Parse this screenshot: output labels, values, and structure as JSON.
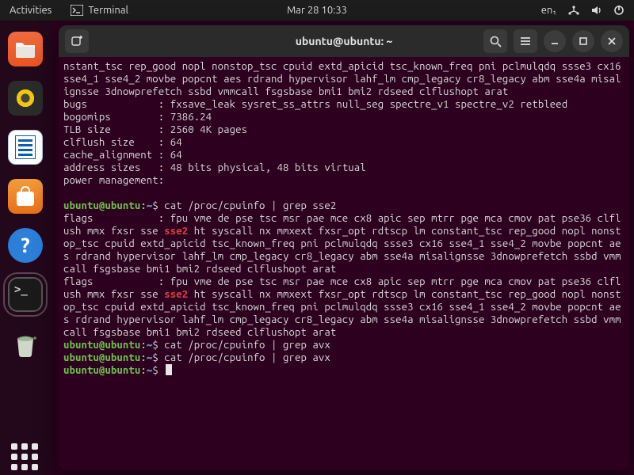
{
  "topbar": {
    "activities": "Activities",
    "app_label": "Terminal",
    "clock": "Mar 28  10:33",
    "lang": "en₁"
  },
  "dock": {
    "items": [
      {
        "name": "files-app"
      },
      {
        "name": "rhythmbox-app"
      },
      {
        "name": "libreoffice-writer-app"
      },
      {
        "name": "ubuntu-software-app"
      },
      {
        "name": "help-app"
      },
      {
        "name": "terminal-app",
        "active": true
      },
      {
        "name": "trash"
      }
    ],
    "show_apps": "show-applications"
  },
  "terminal": {
    "title": "ubuntu@ubuntu: ~",
    "prompt": {
      "userhost": "ubuntu@ubuntu",
      "path": "~",
      "sep": ":"
    },
    "scrollback": {
      "flags_tail": "nstant_tsc rep_good nopl nonstop_tsc cpuid extd_apicid tsc_known_freq pni pclmulqdq ssse3 cx16 sse4_1 sse4_2 movbe popcnt aes rdrand hypervisor lahf_lm cmp_legacy cr8_legacy abm sse4a misalignsse 3dnowprefetch ssbd vmmcall fsgsbase bmi1 bmi2 rdseed clflushopt arat",
      "bugs_label": "bugs",
      "bugs_value": "fxsave_leak sysret_ss_attrs null_seg spectre_v1 spectre_v2 retbleed",
      "bogomips_label": "bogomips",
      "bogomips_value": "7386.24",
      "tlb_label": "TLB size",
      "tlb_value": "2560 4K pages",
      "clflush_label": "clflush size",
      "clflush_value": "64",
      "cache_label": "cache_alignment",
      "cache_value": "64",
      "addr_label": "address sizes",
      "addr_value": "48 bits physical, 48 bits virtual",
      "pm_label": "power management:"
    },
    "cmd1": "cat /proc/cpuinfo | grep sse2",
    "flags_block": {
      "pre": "flags           : fpu vme de pse tsc msr pae mce cx8 apic sep mtrr pge mca cmov pat pse36 clflush mmx fxsr sse ",
      "match": "sse2",
      "post": " ht syscall nx mmxext fxsr_opt rdtscp lm constant_tsc rep_good nopl nonstop_tsc cpuid extd_apicid tsc_known_freq pni pclmulqdq ssse3 cx16 sse4_1 sse4_2 movbe popcnt aes rdrand hypervisor lahf_lm cmp_legacy cr8_legacy abm sse4a misalignsse 3dnowprefetch ssbd vmmcall fsgsbase bmi1 bmi2 rdseed clflushopt arat"
    },
    "cmd2": "cat /proc/cpuinfo | grep avx",
    "cmd3": "cat /proc/cpuinfo | grep avx"
  }
}
